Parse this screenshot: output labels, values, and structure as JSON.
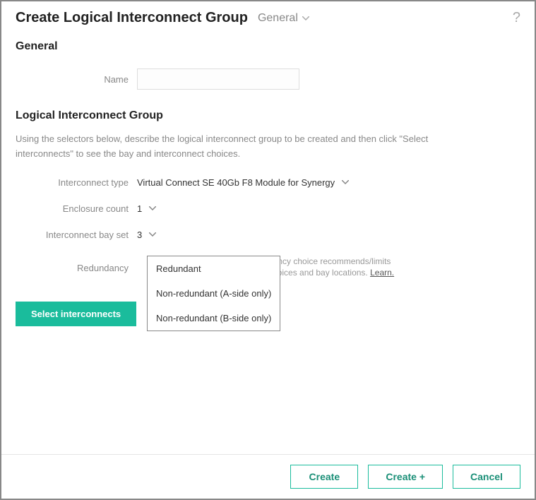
{
  "header": {
    "title": "Create Logical Interconnect Group",
    "section": "General",
    "help": "?"
  },
  "general": {
    "heading": "General",
    "name_label": "Name",
    "name_value": ""
  },
  "lig": {
    "heading": "Logical Interconnect Group",
    "description": "Using the selectors below, describe the logical interconnect group to be created and then click \"Select interconnects\" to see the bay and interconnect choices.",
    "interconnect_type_label": "Interconnect type",
    "interconnect_type_value": "Virtual Connect SE 40Gb F8 Module for Synergy",
    "enclosure_count_label": "Enclosure count",
    "enclosure_count_value": "1",
    "bay_set_label": "Interconnect bay set",
    "bay_set_value": "3",
    "redundancy_label": "Redundancy",
    "redundancy_hint_line1": "dancy choice recommends/limits",
    "redundancy_hint_line2": "choices and bay locations. ",
    "learn": "Learn.",
    "select_button": "Select interconnects",
    "redundancy_options": [
      "Redundant",
      "Non-redundant (A-side only)",
      "Non-redundant (B-side only)"
    ]
  },
  "footer": {
    "create": "Create",
    "create_plus": "Create +",
    "cancel": "Cancel"
  }
}
